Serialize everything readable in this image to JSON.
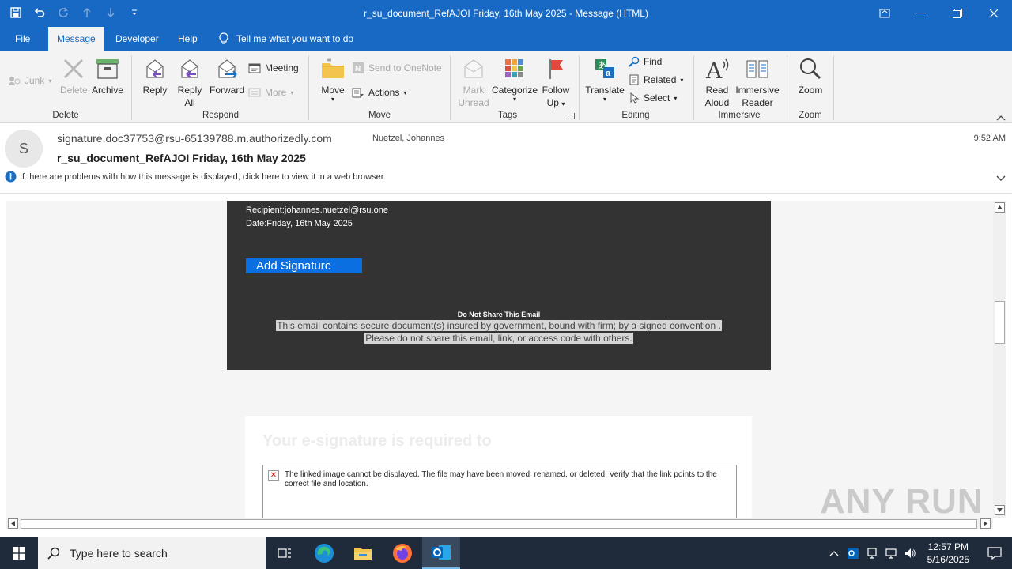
{
  "window": {
    "title": "r_su_document_RefAJOI Friday, 16th May 2025  -  Message (HTML)"
  },
  "tabs": [
    {
      "label": "File"
    },
    {
      "label": "Message"
    },
    {
      "label": "Developer"
    },
    {
      "label": "Help"
    }
  ],
  "tellme": "Tell me what you want to do",
  "ribbon": {
    "junk": "Junk",
    "delete": "Delete",
    "archive": "Archive",
    "group_delete": "Delete",
    "reply": "Reply",
    "reply_all_1": "Reply",
    "reply_all_2": "All",
    "forward": "Forward",
    "meeting": "Meeting",
    "more": "More",
    "group_respond": "Respond",
    "move": "Move",
    "send_onenote": "Send to OneNote",
    "actions": "Actions",
    "group_move": "Move",
    "mark_unread_1": "Mark",
    "mark_unread_2": "Unread",
    "categorize": "Categorize",
    "follow_up_1": "Follow",
    "follow_up_2": "Up",
    "group_tags": "Tags",
    "translate": "Translate",
    "find": "Find",
    "related": "Related",
    "select": "Select",
    "group_editing": "Editing",
    "read_aloud_1": "Read",
    "read_aloud_2": "Aloud",
    "immersive_1": "Immersive",
    "immersive_2": "Reader",
    "group_immersive": "Immersive",
    "zoom": "Zoom",
    "group_zoom": "Zoom"
  },
  "message": {
    "avatar_initial": "S",
    "sender": "signature.doc37753@rsu-65139788.m.authorizedly.com",
    "to": "Nuetzel, Johannes",
    "time": "9:52 AM",
    "subject": "r_su_document_RefAJOI Friday, 16th May 2025",
    "info": "If there are problems with how this message is displayed, click here to view it in a web browser."
  },
  "email_body": {
    "recipient": "Recipient:johannes.nuetzel@rsu.one",
    "date": "Date:Friday, 16th May 2025",
    "button": "Add Signature",
    "notice_title": "Do Not Share This Email",
    "notice_line1": "This email contains secure document(s) insured by government, bound with firm; by a signed convention .",
    "notice_line2": "Please do not share this email, link, or access code with others.",
    "faded_heading": "Your e-signature is required to",
    "broken_image": "The linked image cannot be displayed.  The file may have been moved, renamed, or deleted. Verify that the link points to the correct file and location."
  },
  "watermark": "ANY RUN",
  "taskbar": {
    "search_placeholder": "Type here to search",
    "time": "12:57 PM",
    "date": "5/16/2025"
  },
  "colors": {
    "brand_blue": "#1769c4",
    "signature_button": "#0a6fe0",
    "email_dark_bg": "#333333",
    "taskbar": "#1f2a3a"
  }
}
